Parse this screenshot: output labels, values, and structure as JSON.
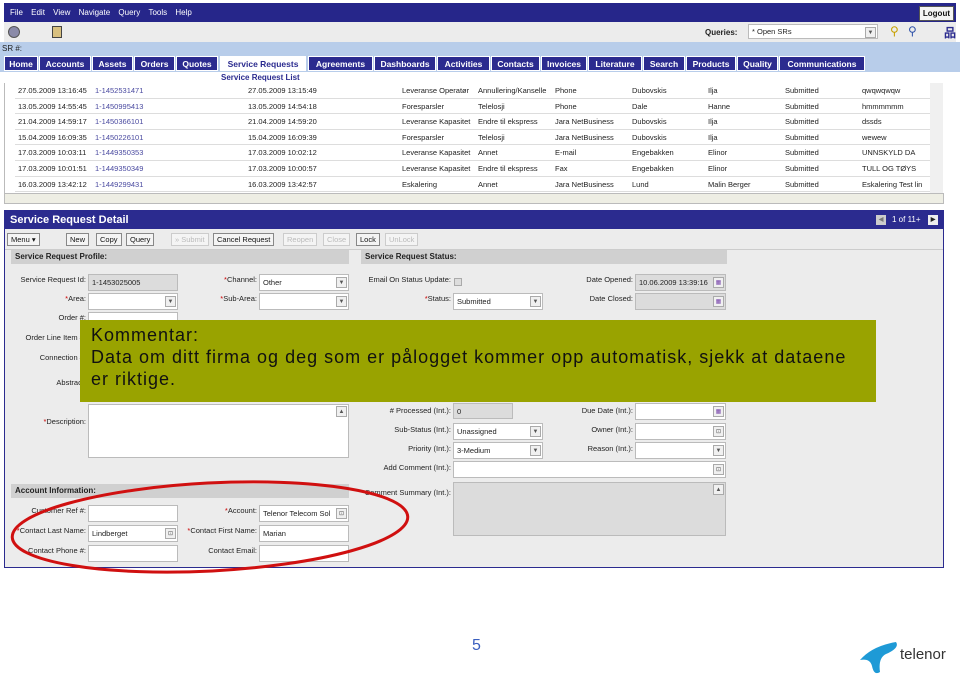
{
  "menu": [
    "File",
    "Edit",
    "View",
    "Navigate",
    "Query",
    "Tools",
    "Help"
  ],
  "logout": "Logout",
  "queries_label": "Queries:",
  "queries_value": "* Open SRs",
  "sr_label": "SR #:",
  "tabs": [
    "Home",
    "Accounts",
    "Assets",
    "Orders",
    "Quotes",
    "Service Requests",
    "Agreements",
    "Dashboards",
    "Activities",
    "Contacts",
    "Invoices",
    "Literature",
    "Search",
    "Products",
    "Quality",
    "Communications"
  ],
  "active_tab": "Service Requests",
  "list_title": "Service Request List",
  "rows": [
    [
      "27.05.2009 13:16:45",
      "1-1452531471",
      "27.05.2009 13:15:49",
      "Leveranse Operatør",
      "Annullering/Kanselle",
      "Phone",
      "Dubovskis",
      "Ilja",
      "Submitted",
      "qwqwqwqw"
    ],
    [
      "13.05.2009 14:55:45",
      "1-1450995413",
      "13.05.2009 14:54:18",
      "Foresparsler",
      "Telelosji",
      "Phone",
      "Dale",
      "Hanne",
      "Submitted",
      "hmmmmmm"
    ],
    [
      "21.04.2009 14:59:17",
      "1-1450366101",
      "21.04.2009 14:59:20",
      "Leveranse Kapasitet",
      "Endre til ekspress",
      "Jara NetBusiness",
      "Dubovskis",
      "Ilja",
      "Submitted",
      "dssds"
    ],
    [
      "15.04.2009 16:09:35",
      "1-1450226101",
      "15.04.2009 16:09:39",
      "Foresparsler",
      "Telelosji",
      "Jara NetBusiness",
      "Dubovskis",
      "Ilja",
      "Submitted",
      "wewew"
    ],
    [
      "17.03.2009 10:03:11",
      "1-1449350353",
      "17.03.2009 10:02:12",
      "Leveranse Kapasitet",
      "Annet",
      "E-mail",
      "Engebakken",
      "Elinor",
      "Submitted",
      "UNNSKYLD DA"
    ],
    [
      "17.03.2009 10:01:51",
      "1-1449350349",
      "17.03.2009 10:00:57",
      "Leveranse Kapasitet",
      "Endre til ekspress",
      "Fax",
      "Engebakken",
      "Elinor",
      "Submitted",
      "TULL OG TØYS"
    ],
    [
      "16.03.2009 13:42:12",
      "1-1449299431",
      "16.03.2009 13:42:57",
      "Eskalering",
      "Annet",
      "Jara NetBusiness",
      "Lund",
      "Malin Berger",
      "Submitted",
      "Eskalering  Test lin"
    ]
  ],
  "detail": {
    "title": "Service Request Detail",
    "record_counter": "1 of 11+",
    "buttons": {
      "menu": "Menu ▾",
      "new": "New",
      "copy": "Copy",
      "query": "Query",
      "submit": "» Submit",
      "cancel": "Cancel Request",
      "reopen": "Reopen",
      "close": "Close",
      "lock": "Lock",
      "unlock": "UnLock"
    },
    "profile_header": "Service Request Profile:",
    "status_header": "Service Request Status:",
    "account_header": "Account Information:",
    "labels": {
      "sr_id": "Service Request Id:",
      "channel": "Channel:",
      "area": "Area:",
      "sub_area": "Sub-Area:",
      "order": "Order #:",
      "order_line": "Order Line Item #:",
      "connection": "Connection #:",
      "abstract": "Abstract:",
      "description": "Description:",
      "email_update": "Email On Status Update:",
      "status": "Status:",
      "date_opened": "Date Opened:",
      "date_closed": "Date Closed:",
      "processed": "# Processed (Int.):",
      "sub_status": "Sub-Status (Int.):",
      "priority": "Priority (Int.):",
      "add_comment": "Add Comment (Int.):",
      "comment_summary": "Comment Summary (Int.):",
      "due_date": "Due Date (Int.):",
      "owner": "Owner (Int.):",
      "reason": "Reason (Int.):",
      "customer_ref": "Customer Ref #:",
      "account": "Account:",
      "contact_last": "Contact Last Name:",
      "contact_first": "Contact First Name:",
      "contact_phone": "Contact Phone #:",
      "contact_email": "Contact Email:"
    },
    "values": {
      "sr_id": "1-1453025005",
      "channel": "Other",
      "status": "Submitted",
      "date_opened": "10.06.2009 13:39:16",
      "processed": "0",
      "sub_status": "Unassigned",
      "priority": "3-Medium",
      "account": "Telenor Telecom Sol",
      "contact_last": "Lindberget",
      "contact_first": "Marian"
    }
  },
  "overlay": {
    "line1": "Kommentar:",
    "line2": "Data om ditt firma og deg som er pålogget kommer opp automatisk, sjekk at dataene er riktige."
  },
  "page_number": "5",
  "logo": "telenor",
  "colors": {
    "nav": "#2b2b8f",
    "overlay": "#99a300",
    "highlight_ellipse": "#d01010",
    "logo": "#1e9ad6"
  }
}
